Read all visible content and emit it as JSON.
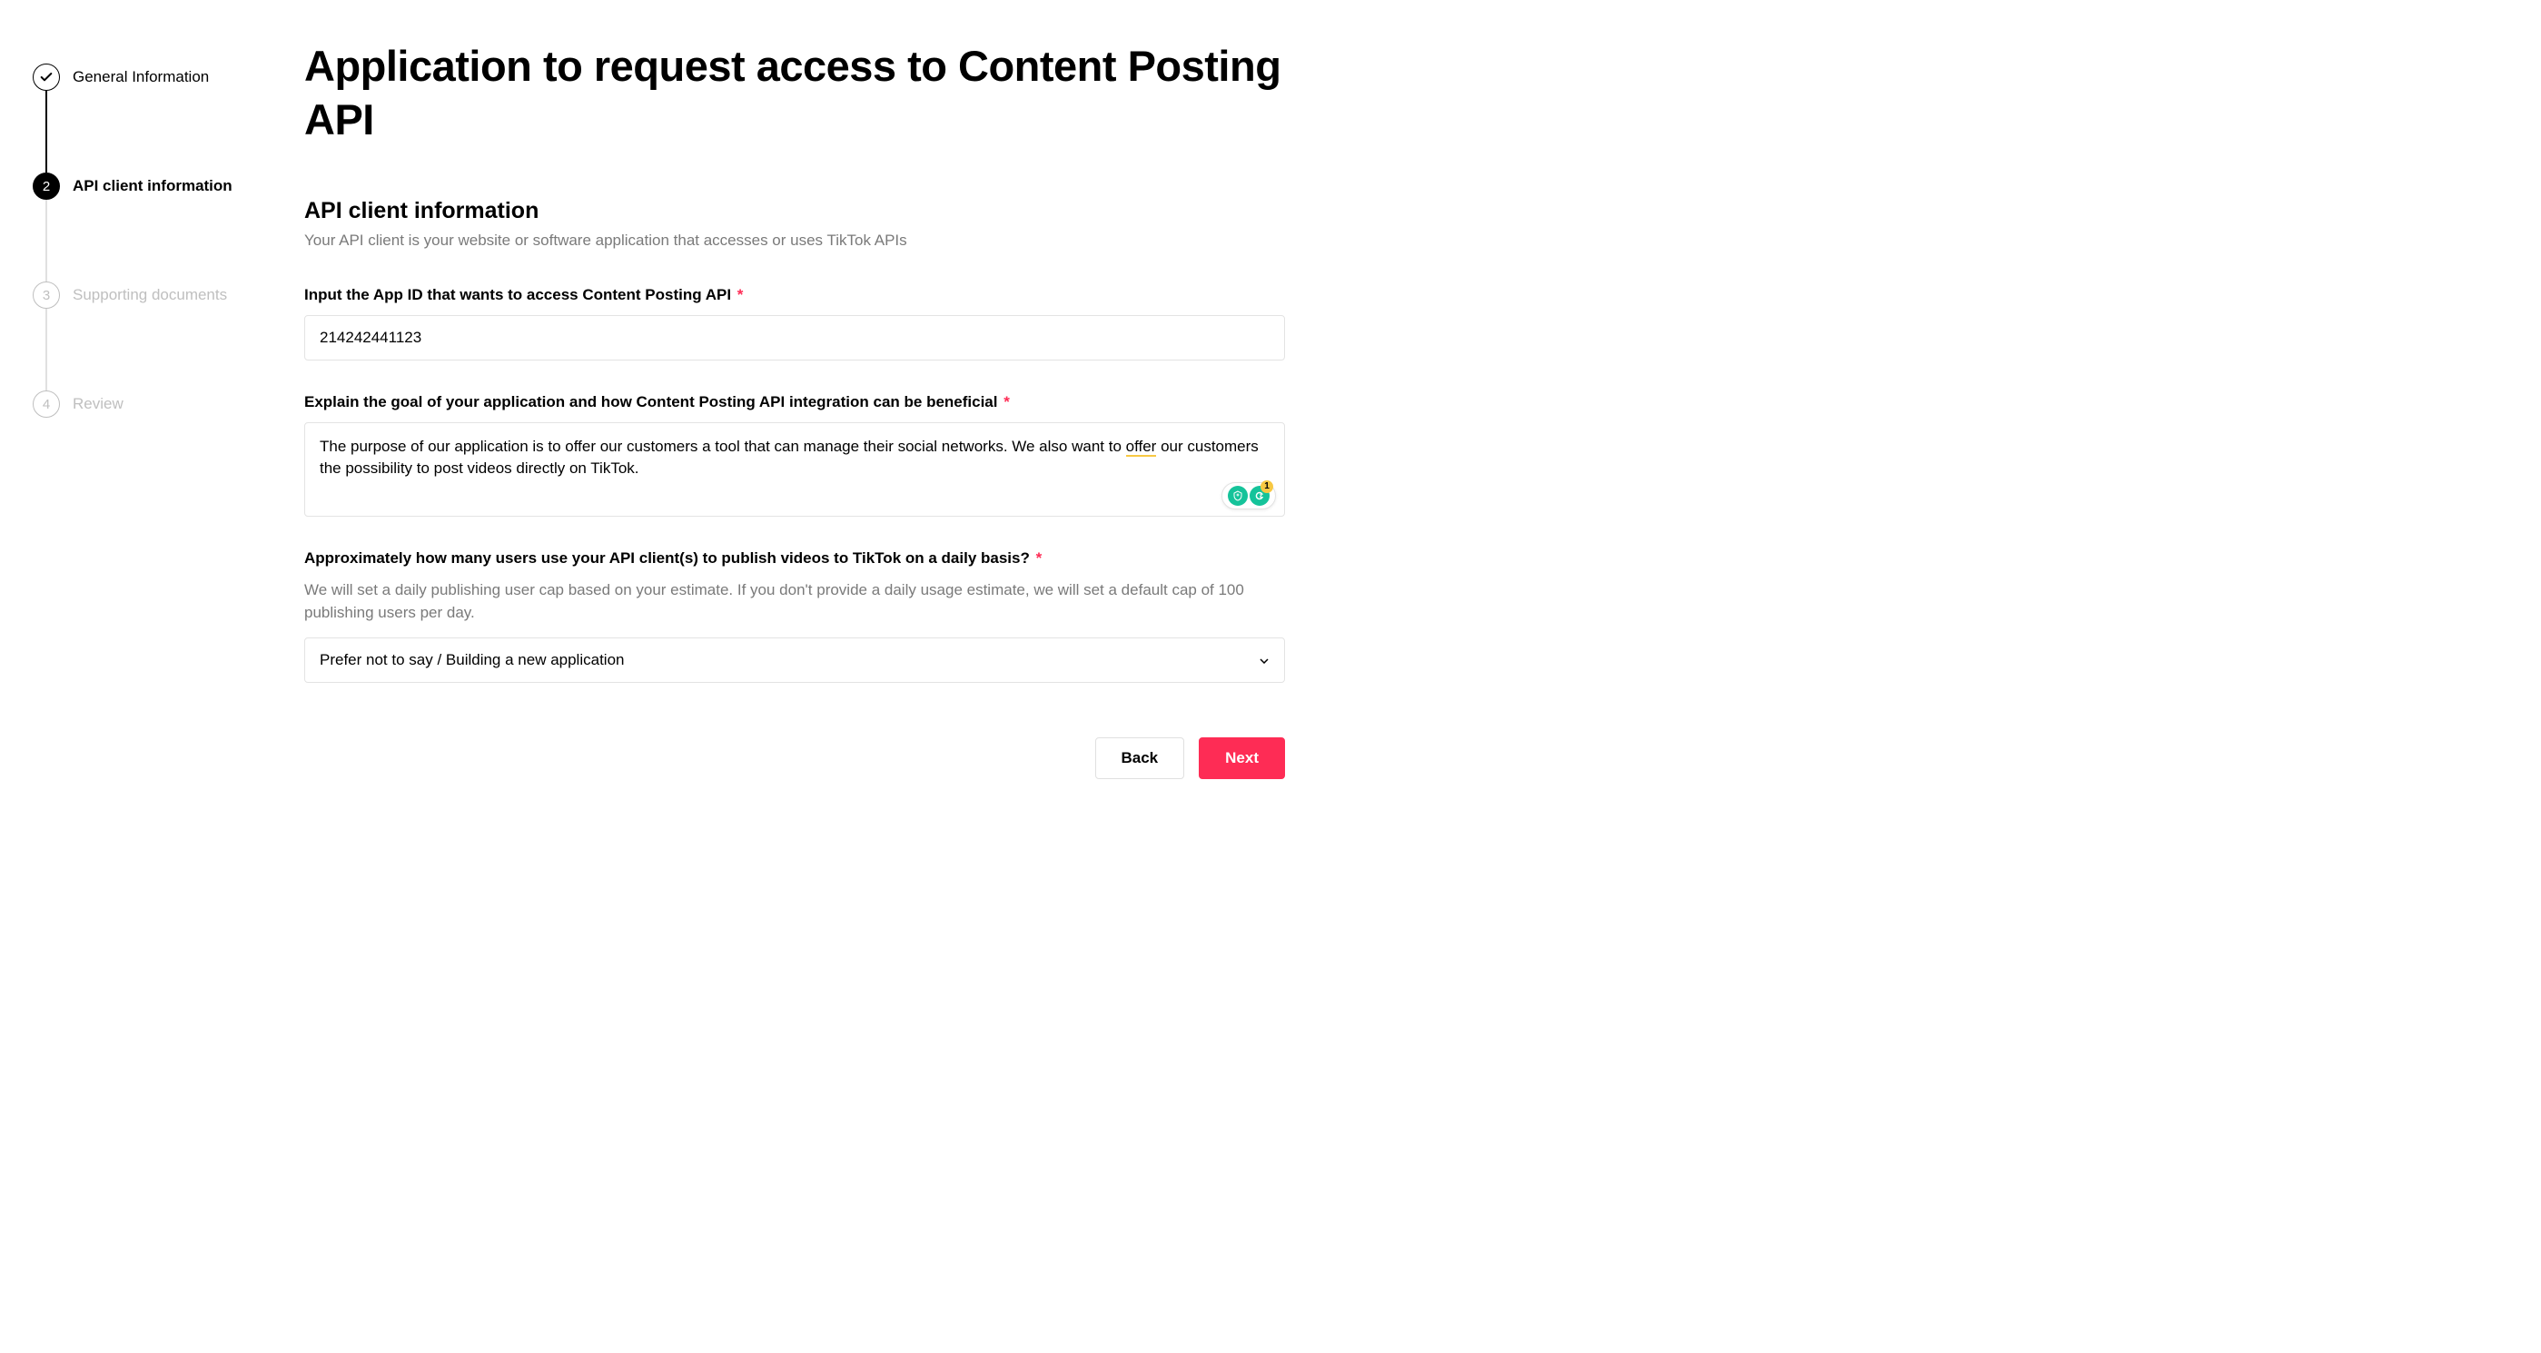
{
  "steps": [
    {
      "label": "General Information",
      "state": "completed"
    },
    {
      "label": "API client information",
      "state": "active",
      "number": "2"
    },
    {
      "label": "Supporting documents",
      "state": "inactive",
      "number": "3"
    },
    {
      "label": "Review",
      "state": "inactive",
      "number": "4"
    }
  ],
  "page": {
    "title": "Application to request access to Content Posting API"
  },
  "section": {
    "title": "API client information",
    "subtitle": "Your API client is your website or software application that accesses or uses TikTok APIs"
  },
  "fields": {
    "app_id": {
      "label": "Input the App ID that wants to access Content Posting API",
      "value": "214242441123"
    },
    "goal": {
      "label": "Explain the goal of your application and how Content Posting API integration can be beneficial",
      "value_part1": "The purpose of our application is to offer our customers a tool that can manage their social networks. We also want to ",
      "value_underlined": "offer",
      "value_part2": " our customers the possibility to post videos directly on TikTok."
    },
    "users": {
      "label": "Approximately how many users use your API client(s) to publish videos to TikTok on a daily basis?",
      "help": "We will set a daily publishing user cap based on your estimate. If you don't provide a daily usage estimate, we will set a default cap of 100 publishing users per day.",
      "selected": "Prefer not to say / Building a new application"
    }
  },
  "buttons": {
    "back": "Back",
    "next": "Next"
  },
  "required_mark": "*",
  "grammarly_count": "1"
}
